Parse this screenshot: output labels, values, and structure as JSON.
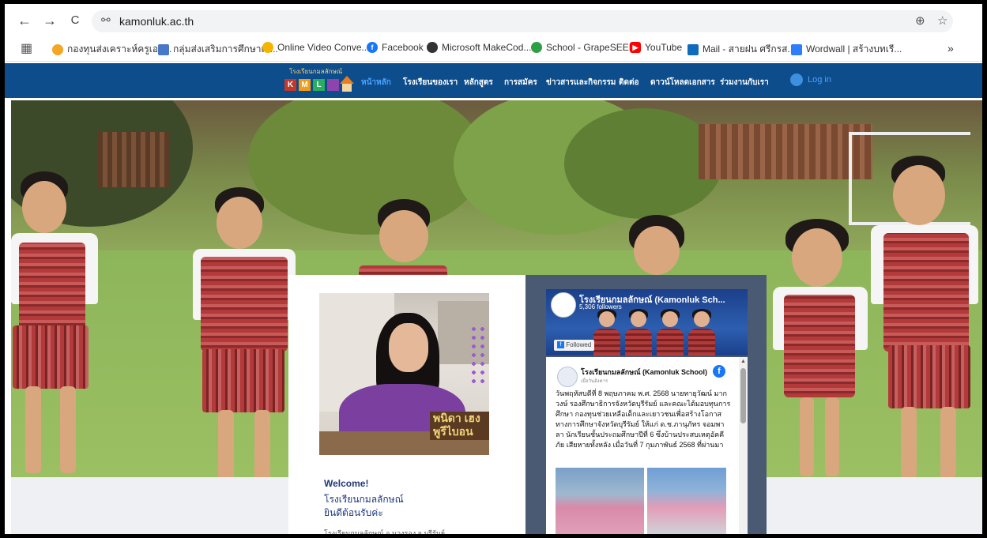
{
  "browser": {
    "back_icon": "←",
    "forward_icon": "→",
    "reload_icon": "C",
    "site_info_icon": "⚯",
    "url": "kamonluk.ac.th",
    "zoom_icon": "⊕",
    "star_icon": "☆",
    "overflow_icon": "»"
  },
  "bookmarks": [
    {
      "label": "กองทุนส่งเคราะห์ครูเอก...",
      "icon_color": "#f5a623"
    },
    {
      "label": "กลุ่มส่งเสริมการศึกษาเอ...",
      "icon_color": "#4a78c9"
    },
    {
      "label": "Online Video Conve...",
      "icon_color": "#f4b400"
    },
    {
      "label": "Facebook",
      "icon_color": "#1877f2"
    },
    {
      "label": "Microsoft MakeCod...",
      "icon_color": "#333333"
    },
    {
      "label": "School - GrapeSEED",
      "icon_color": "#2ea043"
    },
    {
      "label": "YouTube",
      "icon_color": "#ff0000"
    },
    {
      "label": "Mail - สายฝน ศรีกรส...",
      "icon_color": "#0f6cbd"
    },
    {
      "label": "Wordwall | สร้างบทเรี...",
      "icon_color": "#2d7ff9"
    }
  ],
  "site": {
    "logo_title": "โรงเรียนกมลลักษณ์",
    "logo_letters": [
      "K",
      "M",
      "L"
    ],
    "menu": [
      "หน้าหลัก",
      "โรงเรียนของเรา",
      "หลักสูตร",
      "การสมัคร",
      "ข่าวสารและกิจกรรม",
      "ติดต่อ",
      "ดาวน์โหลดเอกสาร",
      "ร่วมงานกับเรา"
    ],
    "login_label": "Log in",
    "active_color": "#4aa3ff",
    "nav_color": "#0e4d8b"
  },
  "welcome_card": {
    "plate_text": "พนิดา เฮง\nพูรีไบอน",
    "welcome": "Welcome!",
    "school_name": "โรงเรียนกมลลักษณ์",
    "greeting": "ยินดีต้อนรับค่ะ",
    "address": "โรงเรียนกมลลักษณ์ อ.นางรอง จ.บุรีรัมย์"
  },
  "facebook_widget": {
    "page_title": "โรงเรียนกมลลักษณ์ (Kamonluk Sch...",
    "followers": "5,306 followers",
    "followed_label": "Followed",
    "post_author": "โรงเรียนกมลลักษณ์ (Kamonluk School)",
    "post_time": "เมื่อวันอังคาร",
    "post_text": "วันพฤหัสบดีที่ 8 พฤษภาคม พ.ศ. 2568 นายทายุวัฒน์ มากวงษ์ รองศึกษาธิการจังหวัดบุรีรัมย์ และคณะได้มอบทุนการศึกษา กองทุนช่วยเหลือเด็กและเยาวชนเพื่อสร้างโอกาสทางการศึกษาจังหวัดบุรีรัมย์ ให้แก่ ด.ช.ภานุภัทร จอมพาลา นักเรียนชั้นประถมศึกษาปีที่ 6 ซึ่งบ้านประสบเหตุอัคคีภัย เสียหายทั้งหลัง เมื่อวันที่ 7 กุมภาพันธ์ 2568 ที่ผ่านมา"
  }
}
